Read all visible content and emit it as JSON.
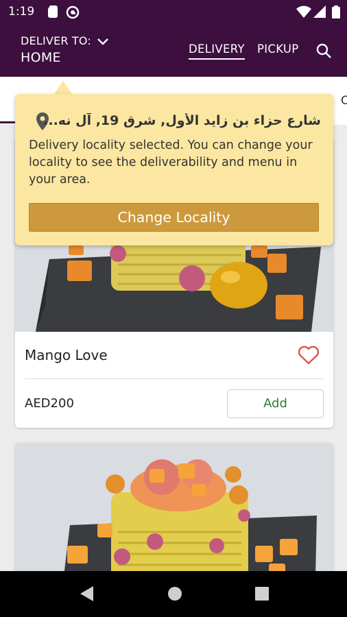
{
  "status_bar": {
    "time": "1:19",
    "icons": [
      "sd-card-icon",
      "at-sign-icon",
      "wifi-icon",
      "signal-icon",
      "battery-icon"
    ]
  },
  "header": {
    "deliver_to_label": "DELIVER TO:",
    "location_label": "HOME",
    "tabs": [
      {
        "label": "DELIVERY",
        "active": true
      },
      {
        "label": "PICKUP",
        "active": false
      }
    ],
    "colors": {
      "background": "#3c0f3e",
      "text": "#ffffff"
    }
  },
  "category_strip": {
    "peek_text": "C"
  },
  "tooltip": {
    "address": "شارع حزاء بن زايد الأول, شرق 19, آل نه...",
    "message": "Delivery locality selected. You can change your locality to see the deliverability and menu in your area.",
    "button_label": "Change Locality",
    "colors": {
      "background": "#fbe7a1",
      "button": "#cc9a3c"
    }
  },
  "products": [
    {
      "name": "Mango Love",
      "price": "AED200",
      "add_label": "Add",
      "favorite": false
    },
    {
      "name": "",
      "price": "",
      "add_label": "",
      "favorite": false
    }
  ],
  "colors": {
    "add_text": "#2e7d32",
    "heart": "#d9534f"
  }
}
